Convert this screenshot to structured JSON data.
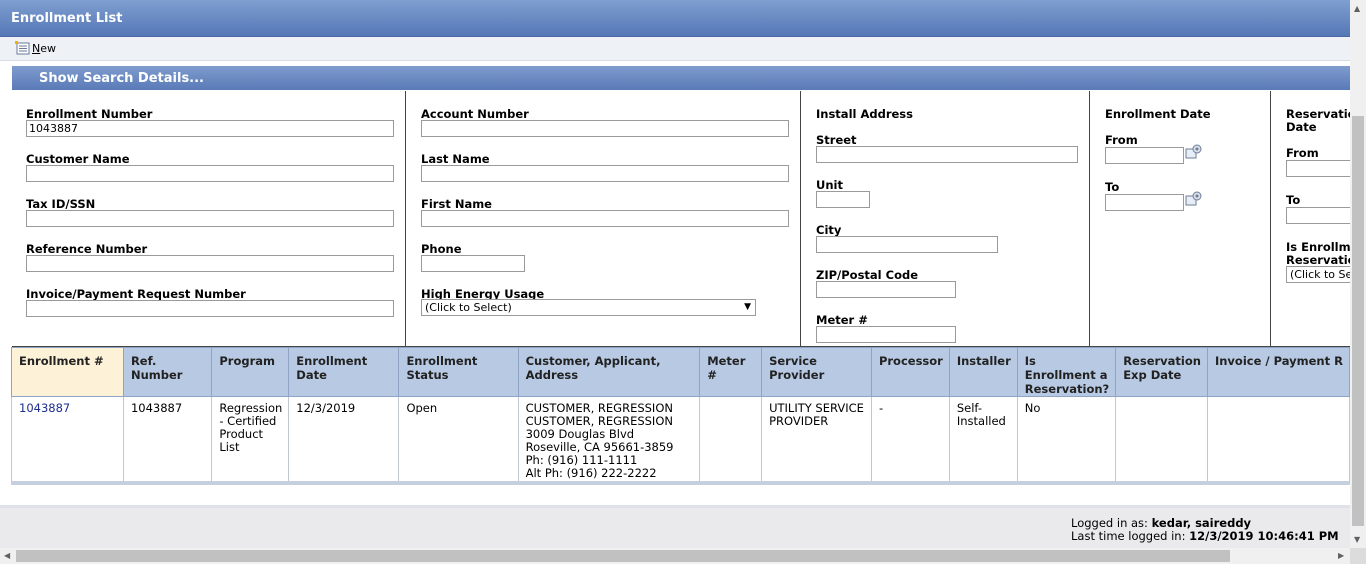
{
  "title": "Enrollment List",
  "toolbar": {
    "new_label": "New",
    "new_icon": "new-document-icon"
  },
  "search": {
    "header": "Show Search Details...",
    "enrollment_number": {
      "label": "Enrollment Number",
      "value": "1043887"
    },
    "customer_name": {
      "label": "Customer Name",
      "value": ""
    },
    "tax_id": {
      "label": "Tax ID/SSN",
      "value": ""
    },
    "reference_number": {
      "label": "Reference Number",
      "value": ""
    },
    "invoice_number": {
      "label": "Invoice/Payment Request Number",
      "value": ""
    },
    "account_number": {
      "label": "Account Number",
      "value": ""
    },
    "last_name": {
      "label": "Last Name",
      "value": ""
    },
    "first_name": {
      "label": "First Name",
      "value": ""
    },
    "phone": {
      "label": "Phone",
      "value": ""
    },
    "high_energy_usage": {
      "label": "High Energy Usage",
      "value": "(Click to Select)"
    },
    "install_address": {
      "label": "Install Address",
      "street": {
        "label": "Street",
        "value": ""
      },
      "unit": {
        "label": "Unit",
        "value": ""
      },
      "city": {
        "label": "City",
        "value": ""
      },
      "zip": {
        "label": "ZIP/Postal Code",
        "value": ""
      },
      "meter": {
        "label": "Meter #",
        "value": ""
      }
    },
    "enrollment_date": {
      "label": "Enrollment Date",
      "from_label": "From",
      "to_label": "To"
    },
    "reservation_date": {
      "label_line1": "Reservation",
      "label_line2": "Date",
      "from_label": "From",
      "to_label": "To",
      "is_enrollment_line1": "Is Enrollme",
      "is_enrollment_line2": "Reservatio",
      "is_enrollment_value": "(Click to Se"
    }
  },
  "grid": {
    "columns": [
      "Enrollment #",
      "Ref. Number",
      "Program",
      "Enrollment Date",
      "Enrollment Status",
      "Customer, Applicant, Address",
      "Meter #",
      "Service Provider",
      "Processor",
      "Installer",
      "Is Enrollment a Reservation?",
      "Reservation Exp Date",
      "Invoice / Payment R"
    ],
    "rows": [
      {
        "enrollment": "1043887",
        "ref": "1043887",
        "program": "Regression - Certified Product List",
        "date": "12/3/2019",
        "status": "Open",
        "customer_lines": [
          "CUSTOMER, REGRESSION",
          "CUSTOMER, REGRESSION",
          "3009 Douglas Blvd",
          "Roseville, CA 95661-3859",
          "Ph: (916) 111-1111",
          "Alt Ph: (916) 222-2222"
        ],
        "meter": "",
        "service_provider": "UTILITY SERVICE PROVIDER",
        "processor": "-",
        "installer": "Self-Installed",
        "is_reservation": "No",
        "reservation_exp": "",
        "invoice": ""
      }
    ]
  },
  "footer": {
    "logged_in_label": "Logged in as:",
    "user": "kedar, saireddy",
    "last_login_label": "Last time logged in:",
    "last_login": "12/3/2019 10:46:41 PM"
  }
}
